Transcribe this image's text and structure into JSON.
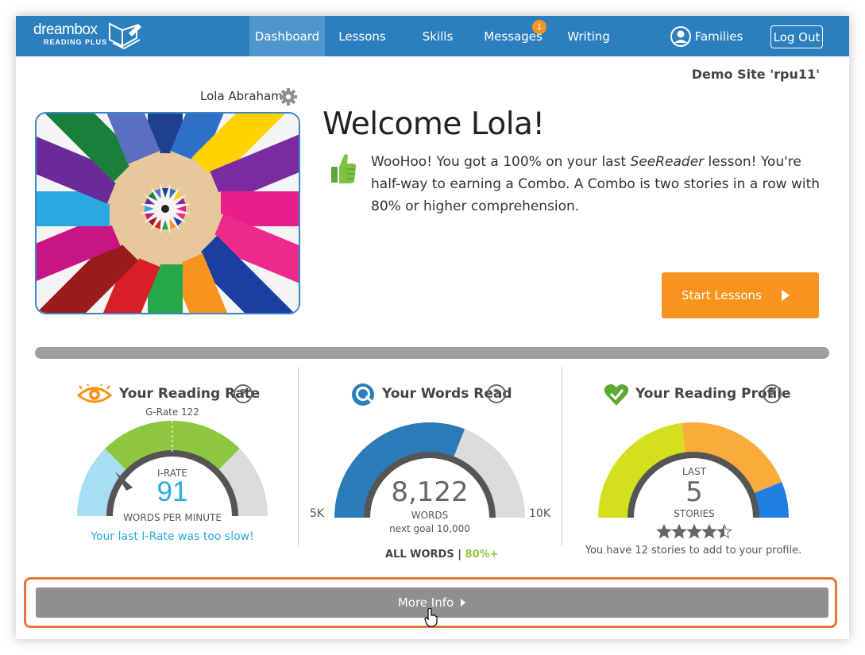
{
  "brand": {
    "name": "dreambox",
    "sub": "READING PLUS"
  },
  "nav": {
    "items": [
      "Dashboard",
      "Lessons",
      "Skills",
      "Messages",
      "Writing"
    ],
    "messages_badge": "1",
    "families": "Families",
    "logout": "Log Out"
  },
  "site_label": "Demo Site 'rpu11'",
  "user": {
    "name": "Lola Abraham"
  },
  "welcome": {
    "title": "Welcome Lola!",
    "msg_part1": "WooHoo! You got a 100% on your last ",
    "msg_italic": "SeeReader",
    "msg_part2": " lesson! You're half-way to earning a Combo. A Combo is two stories in a row with 80% or higher comprehension."
  },
  "start_button": "Start Lessons",
  "reading_rate": {
    "title": "Your Reading Rate",
    "grate_label": "G-Rate 122",
    "irate_label": "I-RATE",
    "value": "91",
    "unit": "WORDS PER MINUTE",
    "note": "Your last I-Rate was too slow!"
  },
  "words_read": {
    "title": "Your Words Read",
    "value": "8,122",
    "words_label": "WORDS",
    "goal": "next goal 10,000",
    "min": "5K",
    "max": "10K",
    "filter_all": "ALL WORDS",
    "filter_sep": " | ",
    "filter_pct": "80%+",
    "fraction": 0.62
  },
  "reading_profile": {
    "title": "Your Reading Profile",
    "last_label": "LAST",
    "value": "5",
    "stories_label": "STORIES",
    "stars": 4.5,
    "note": "You have 12 stories to add to your profile."
  },
  "more_info": "More Info",
  "colors": {
    "nav": "#2c7fbe",
    "accent": "#f7941d",
    "blue_gauge": "#2b7bb9",
    "green_gauge": "#8dc63f",
    "lightblue": "#a8def2",
    "grey": "#dcdcdc",
    "lime": "#d4df1e",
    "orange": "#f9ac3c",
    "brightblue": "#1f7fe0"
  }
}
